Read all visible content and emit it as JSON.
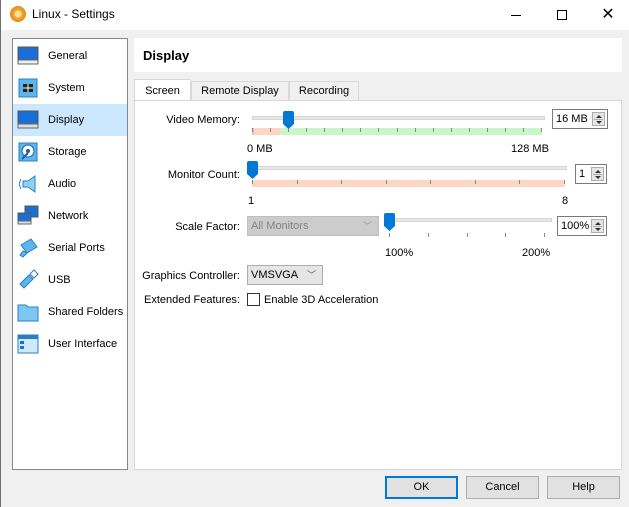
{
  "window": {
    "title": "Linux - Settings",
    "icon": "virtualbox-gear-icon",
    "controls": [
      "minimize",
      "maximize",
      "close"
    ]
  },
  "sidebar": {
    "items": [
      {
        "label": "General",
        "icon": "general-monitor-icon",
        "selected": false
      },
      {
        "label": "System",
        "icon": "system-chip-icon",
        "selected": false
      },
      {
        "label": "Display",
        "icon": "display-monitor-icon",
        "selected": true
      },
      {
        "label": "Storage",
        "icon": "storage-disk-icon",
        "selected": false
      },
      {
        "label": "Audio",
        "icon": "audio-speaker-icon",
        "selected": false
      },
      {
        "label": "Network",
        "icon": "network-icon",
        "selected": false
      },
      {
        "label": "Serial Ports",
        "icon": "serial-port-icon",
        "selected": false
      },
      {
        "label": "USB",
        "icon": "usb-icon",
        "selected": false
      },
      {
        "label": "Shared Folders",
        "icon": "folder-icon",
        "selected": false
      },
      {
        "label": "User Interface",
        "icon": "user-interface-icon",
        "selected": false
      }
    ]
  },
  "panel": {
    "title": "Display",
    "tabs": [
      {
        "label": "Screen",
        "active": true
      },
      {
        "label": "Remote Display",
        "active": false
      },
      {
        "label": "Recording",
        "active": false
      }
    ],
    "screen": {
      "video_memory": {
        "label": "Video Memory:",
        "value": "16 MB",
        "min_label": "0 MB",
        "max_label": "128 MB",
        "min": 0,
        "max": 128,
        "current": 16
      },
      "monitor_count": {
        "label": "Monitor Count:",
        "value": "1",
        "min_label": "1",
        "max_label": "8",
        "min": 1,
        "max": 8,
        "current": 1
      },
      "scale_factor": {
        "label": "Scale Factor:",
        "monitor_select": "All Monitors",
        "value": "100%",
        "min_label": "100%",
        "max_label": "200%",
        "min": 100,
        "max": 200,
        "current": 100
      },
      "graphics_controller": {
        "label": "Graphics Controller:",
        "value": "VMSVGA"
      },
      "extended_features": {
        "label": "Extended Features:",
        "checkbox_label": "Enable 3D Acceleration",
        "checked": false
      }
    }
  },
  "buttons": {
    "ok": "OK",
    "cancel": "Cancel",
    "help": "Help"
  },
  "colors": {
    "accent": "#0078d7",
    "selection": "#cce8ff",
    "scale_good": "#c9f5c9",
    "scale_warn": "#fdd5c4"
  }
}
